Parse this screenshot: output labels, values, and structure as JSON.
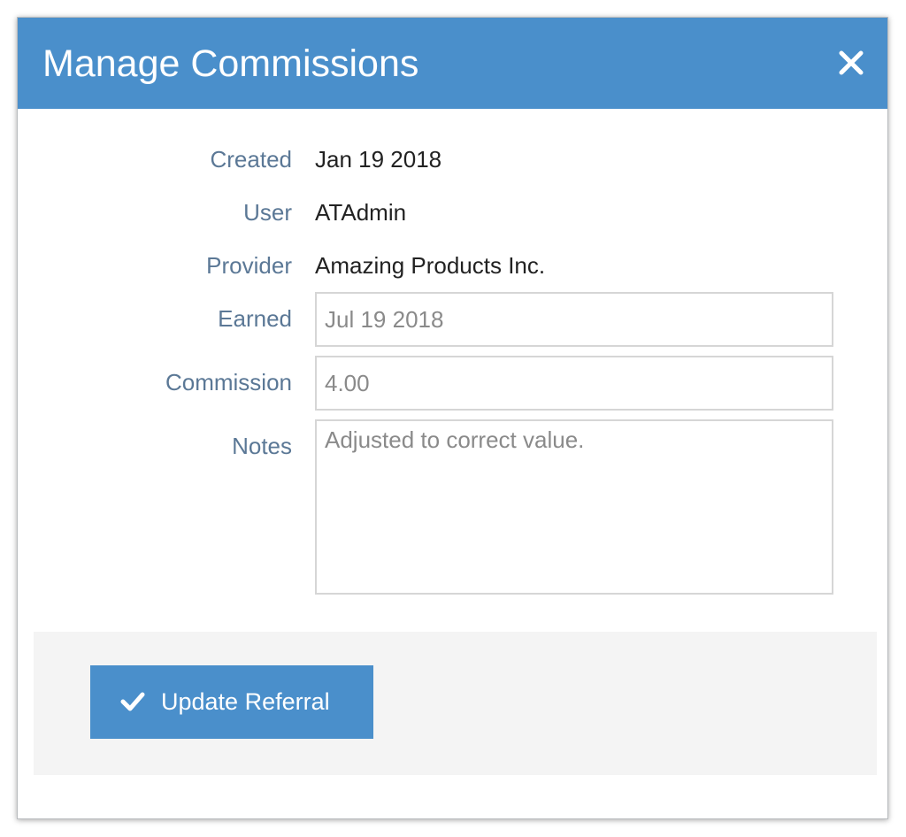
{
  "dialog": {
    "title": "Manage Commissions",
    "close_icon": "close-icon"
  },
  "fields": {
    "created": {
      "label": "Created",
      "value": "Jan 19 2018"
    },
    "user": {
      "label": "User",
      "value": "ATAdmin"
    },
    "provider": {
      "label": "Provider",
      "value": "Amazing Products Inc."
    },
    "earned": {
      "label": "Earned",
      "value": "Jul 19 2018"
    },
    "commission": {
      "label": "Commission",
      "value": "4.00"
    },
    "notes": {
      "label": "Notes",
      "value": "Adjusted to correct value."
    }
  },
  "footer": {
    "update_label": "Update Referral",
    "update_icon": "checkmark-icon"
  },
  "colors": {
    "header": "#4a8fcb",
    "button": "#4a8fcb",
    "label": "#5b7896"
  }
}
